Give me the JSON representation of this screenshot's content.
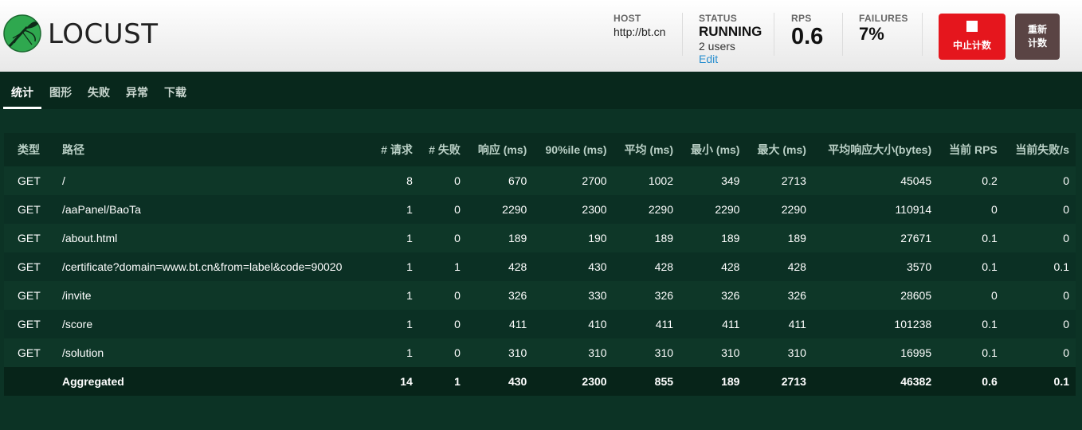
{
  "app": {
    "name": "LOCUST"
  },
  "header": {
    "host_label": "HOST",
    "host_value": "http://bt.cn",
    "status_label": "STATUS",
    "status_value": "RUNNING",
    "users": "2 users",
    "edit_label": "Edit",
    "rps_label": "RPS",
    "rps_value": "0.6",
    "failures_label": "FAILURES",
    "failures_value": "7%",
    "stop_label": "中止计数",
    "reset_label_line1": "重新",
    "reset_label_line2": "计数"
  },
  "tabs": [
    {
      "label": "统计",
      "active": true
    },
    {
      "label": "图形"
    },
    {
      "label": "失败"
    },
    {
      "label": "异常"
    },
    {
      "label": "下载"
    }
  ],
  "table": {
    "columns": [
      "类型",
      "路径",
      "# 请求",
      "# 失败",
      "响应 (ms)",
      "90%ile (ms)",
      "平均 (ms)",
      "最小 (ms)",
      "最大 (ms)",
      "平均响应大小(bytes)",
      "当前 RPS",
      "当前失败/s"
    ],
    "rows": [
      [
        "GET",
        "/",
        "8",
        "0",
        "670",
        "2700",
        "1002",
        "349",
        "2713",
        "45045",
        "0.2",
        "0"
      ],
      [
        "GET",
        "/aaPanel/BaoTa",
        "1",
        "0",
        "2290",
        "2300",
        "2290",
        "2290",
        "2290",
        "110914",
        "0",
        "0"
      ],
      [
        "GET",
        "/about.html",
        "1",
        "0",
        "189",
        "190",
        "189",
        "189",
        "189",
        "27671",
        "0.1",
        "0"
      ],
      [
        "GET",
        "/certificate?domain=www.bt.cn&from=label&code=90020",
        "1",
        "1",
        "428",
        "430",
        "428",
        "428",
        "428",
        "3570",
        "0.1",
        "0.1"
      ],
      [
        "GET",
        "/invite",
        "1",
        "0",
        "326",
        "330",
        "326",
        "326",
        "326",
        "28605",
        "0",
        "0"
      ],
      [
        "GET",
        "/score",
        "1",
        "0",
        "411",
        "410",
        "411",
        "411",
        "411",
        "101238",
        "0.1",
        "0"
      ],
      [
        "GET",
        "/solution",
        "1",
        "0",
        "310",
        "310",
        "310",
        "310",
        "310",
        "16995",
        "0.1",
        "0"
      ]
    ],
    "aggregated": [
      "",
      "Aggregated",
      "14",
      "1",
      "430",
      "2300",
      "855",
      "189",
      "2713",
      "46382",
      "0.6",
      "0.1"
    ]
  },
  "colors": {
    "background": "#0c3325",
    "stop_button": "#e5161d",
    "reset_button": "#5a4444",
    "edit_link": "#2a8fcf"
  }
}
